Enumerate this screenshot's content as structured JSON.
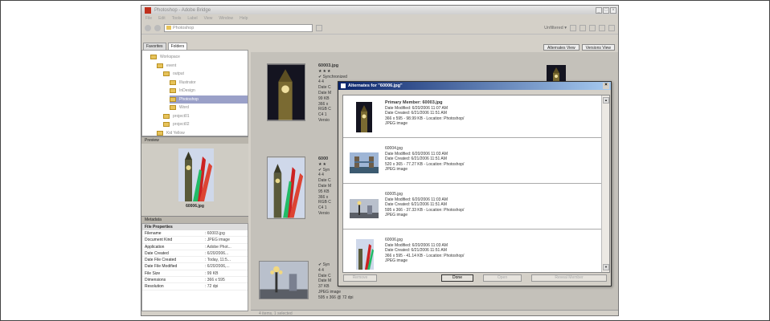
{
  "window": {
    "title": "Photoshop - Adobe Bridge",
    "controls": [
      "_",
      "□",
      "×"
    ]
  },
  "menu": [
    "File",
    "Edit",
    "Tools",
    "Label",
    "View",
    "Window",
    "Help"
  ],
  "toolbar": {
    "path": "Photoshop",
    "workspace": "Unfiltered ▾"
  },
  "left_tabs": [
    "Favorites",
    "Folders"
  ],
  "folders": [
    {
      "label": "Workspace",
      "indent": 0
    },
    {
      "label": "event",
      "indent": 1
    },
    {
      "label": "output",
      "indent": 2
    },
    {
      "label": "Illustrator",
      "indent": 3
    },
    {
      "label": "InDesign",
      "indent": 3
    },
    {
      "label": "Photoshop",
      "indent": 3,
      "selected": true
    },
    {
      "label": "Word",
      "indent": 3
    },
    {
      "label": "project01",
      "indent": 2
    },
    {
      "label": "project02",
      "indent": 2
    },
    {
      "label": "Kid Yellow",
      "indent": 1
    }
  ],
  "preview": {
    "header": "Preview",
    "caption": "60006.jpg"
  },
  "metadata": {
    "header": "Metadata",
    "section": "File Properties",
    "rows": [
      {
        "k": "Filename",
        "v": ": 60003.jpg"
      },
      {
        "k": "Document Kind",
        "v": ": JPEG image"
      },
      {
        "k": "Application",
        "v": ": Adobe Phot..."
      },
      {
        "k": "Date Created",
        "v": ": 6/20/2006..."
      },
      {
        "k": "Date File Created",
        "v": ": Today, 11:5..."
      },
      {
        "k": "Date File Modified",
        "v": ": 6/20/2006,..."
      },
      {
        "k": "File Size",
        "v": ": 99 KB"
      },
      {
        "k": "Dimensions",
        "v": ": 366 x 595"
      },
      {
        "k": "Resolution",
        "v": ": 72 dpi"
      }
    ]
  },
  "content": {
    "view_buttons": [
      "Alternates View",
      "Versions View"
    ],
    "thumbs": [
      {
        "name": "60003.jpg",
        "stars": "★★★",
        "lines": [
          "✔ Synchronized",
          "4 4",
          "Date C",
          "Date M",
          "99 KB",
          "366 x",
          "RGB C",
          "C4 1",
          "Versio"
        ]
      },
      {
        "name": "6000",
        "stars": "★★",
        "lines": [
          "✔ Syn",
          "4 4",
          "Date C",
          "Date M",
          "95 KB",
          "366 x",
          "RGB C",
          "C4 1",
          "Versio"
        ]
      },
      {
        "name": "",
        "stars": "",
        "lines": [
          "✔ Syn",
          "4 4",
          "Date C",
          "Date M",
          "37 KB",
          "JPEG image",
          "595 x 366 @ 72 dpi"
        ]
      }
    ]
  },
  "dialog": {
    "title": "Alternates for \"60006.jpg\"",
    "items": [
      {
        "name": "Primary Member: 60003.jpg",
        "lines": [
          "Date Modified: 6/20/2006 11:07 AM",
          "Date Created: 6/21/2006 11:51 AM",
          "366 x 595 - 98.99 KB - Location: Photoshop/",
          "JPEG image"
        ]
      },
      {
        "name": "60004.jpg",
        "lines": [
          "Date Modified: 6/20/2006 11:03 AM",
          "Date Created: 6/21/2006 11:51 AM",
          "520 x 365 - 77.27 KB - Location: Photoshop/",
          "JPEG image"
        ]
      },
      {
        "name": "60005.jpg",
        "lines": [
          "Date Modified: 6/20/2006 11:03 AM",
          "Date Created: 6/21/2006 11:51 AM",
          "595 x 366 - 37.33 KB - Location: Photoshop/",
          "JPEG image"
        ]
      },
      {
        "name": "60006.jpg",
        "lines": [
          "Date Modified: 6/20/2006 11:03 AM",
          "Date Created: 6/21/2006 11:51 AM",
          "366 x 595 - 41.14 KB - Location: Photoshop/",
          "JPEG image"
        ]
      }
    ],
    "buttons": {
      "remove": "Remove",
      "done": "Done",
      "open": "Open",
      "reveal": "Reveal Member"
    }
  },
  "status": "4 items, 1 selected"
}
